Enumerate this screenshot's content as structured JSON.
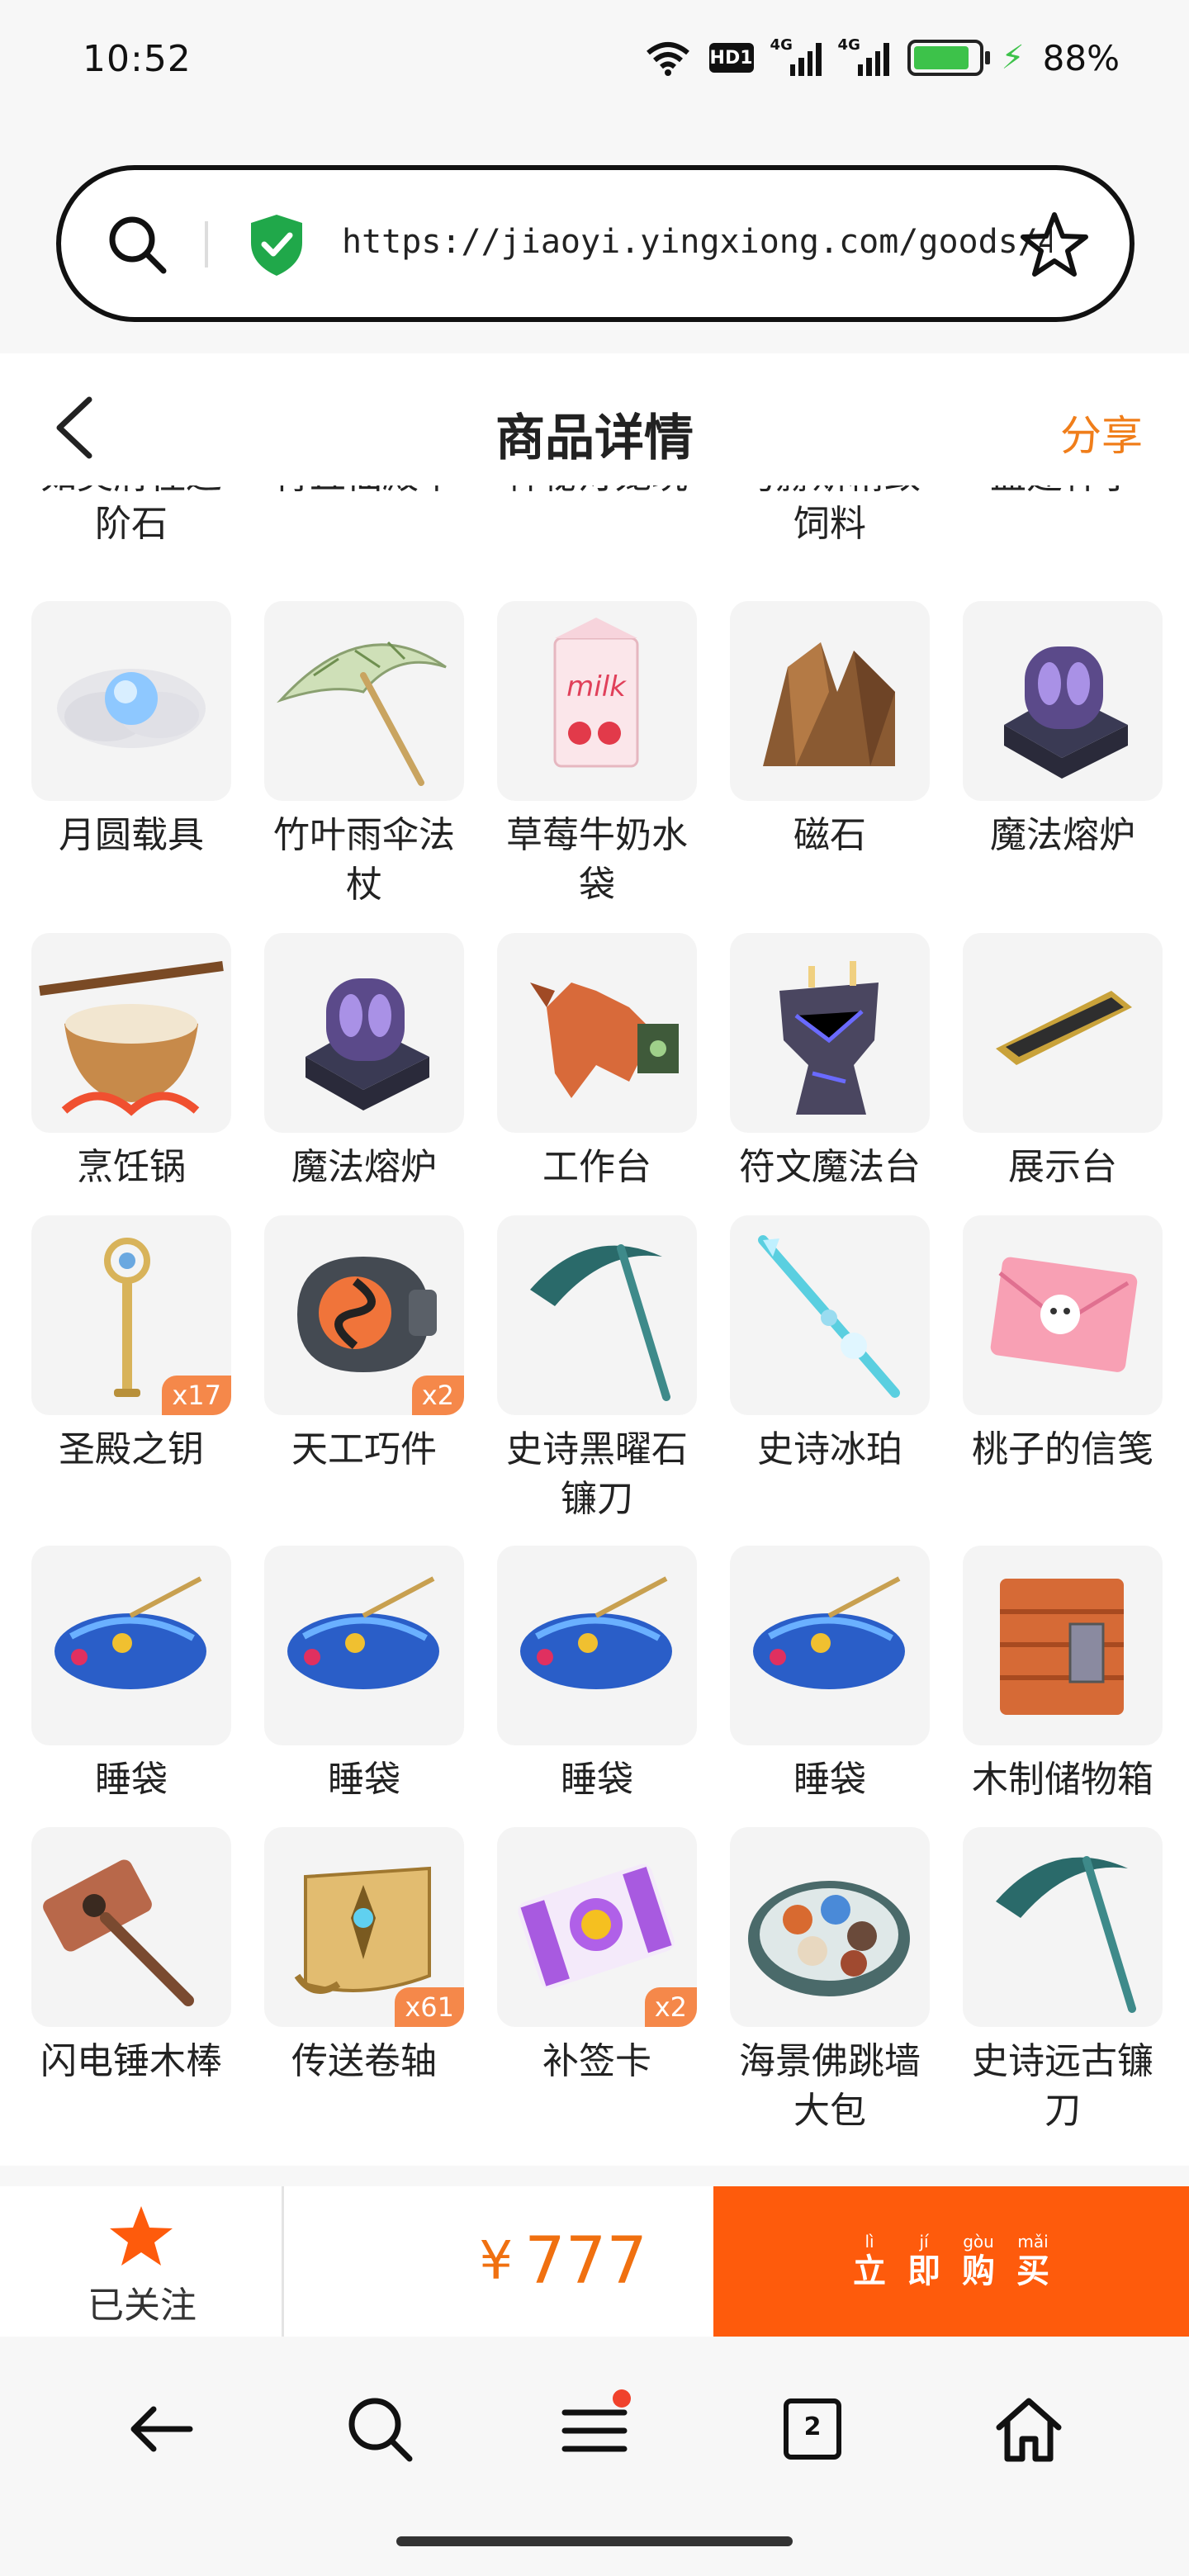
{
  "status_bar": {
    "time": "10:52",
    "hd_label": "HD1",
    "signal_1": "4G",
    "signal_2": "4G",
    "battery_percent": "88%",
    "battery_level": 0.88,
    "battery_color": "#3dc24a"
  },
  "address_bar": {
    "url": "https://jiaoyi.yingxiong.com/goods/43…",
    "secure_icon": "shield-check-icon",
    "secure_color": "#20a84a"
  },
  "header": {
    "title": "商品详情",
    "share_label": "分享",
    "share_color": "#f07e1a"
  },
  "cut_off_row": [
    {
      "line1": "如灵府往返",
      "line2": "阶石"
    },
    {
      "line1": "青丘仙殿草",
      "line2": ""
    },
    {
      "line1": "神秘灯笼玩",
      "line2": ""
    },
    {
      "line1": "马赫斯精致",
      "line2": "饲料"
    },
    {
      "line1": "盖建杆子",
      "line2": ""
    }
  ],
  "items": [
    {
      "name": "月圆载具",
      "qty": "",
      "icon": "moon-orb-icon"
    },
    {
      "name": "竹叶雨伞法杖",
      "qty": "",
      "icon": "bamboo-umbrella-icon"
    },
    {
      "name": "草莓牛奶水袋",
      "qty": "",
      "icon": "milk-carton-icon"
    },
    {
      "name": "磁石",
      "qty": "",
      "icon": "magnet-rock-icon"
    },
    {
      "name": "魔法熔炉",
      "qty": "",
      "icon": "magic-furnace-icon"
    },
    {
      "name": "烹饪锅",
      "qty": "",
      "icon": "cooking-pot-icon"
    },
    {
      "name": "魔法熔炉",
      "qty": "",
      "icon": "magic-furnace-icon"
    },
    {
      "name": "工作台",
      "qty": "",
      "icon": "workbench-icon"
    },
    {
      "name": "符文魔法台",
      "qty": "",
      "icon": "rune-altar-icon"
    },
    {
      "name": "展示台",
      "qty": "",
      "icon": "display-stand-icon"
    },
    {
      "name": "圣殿之钥",
      "qty": "x17",
      "icon": "temple-key-icon"
    },
    {
      "name": "天工巧件",
      "qty": "x2",
      "icon": "craft-part-icon"
    },
    {
      "name": "史诗黑曜石镰刀",
      "qty": "",
      "icon": "scythe-icon"
    },
    {
      "name": "史诗冰珀",
      "qty": "",
      "icon": "ice-spear-icon"
    },
    {
      "name": "桃子的信笺",
      "qty": "",
      "icon": "letter-icon"
    },
    {
      "name": "睡袋",
      "qty": "",
      "icon": "sleeping-bag-icon"
    },
    {
      "name": "睡袋",
      "qty": "",
      "icon": "sleeping-bag-icon"
    },
    {
      "name": "睡袋",
      "qty": "",
      "icon": "sleeping-bag-icon"
    },
    {
      "name": "睡袋",
      "qty": "",
      "icon": "sleeping-bag-icon"
    },
    {
      "name": "木制储物箱",
      "qty": "",
      "icon": "wooden-crate-icon"
    },
    {
      "name": "闪电锤木棒",
      "qty": "",
      "icon": "hammer-icon"
    },
    {
      "name": "传送卷轴",
      "qty": "x61",
      "icon": "scroll-icon"
    },
    {
      "name": "补签卡",
      "qty": "x2",
      "icon": "ticket-icon"
    },
    {
      "name": "海景佛跳墙大包",
      "qty": "",
      "icon": "food-platter-icon"
    },
    {
      "name": "史诗远古镰刀",
      "qty": "",
      "icon": "scythe-icon"
    }
  ],
  "action_bar": {
    "follow_label": "已关注",
    "follow_icon": "star-filled-icon",
    "currency": "¥",
    "price": "777",
    "buy_chars": [
      {
        "pinyin": "lì",
        "hanzi": "立"
      },
      {
        "pinyin": "jí",
        "hanzi": "即"
      },
      {
        "pinyin": "gòu",
        "hanzi": "购"
      },
      {
        "pinyin": "mǎi",
        "hanzi": "买"
      }
    ],
    "buy_color": "#fe5b0c",
    "price_color": "#f07010"
  },
  "nav_bar": {
    "tab_count": "2",
    "buttons": [
      "back-arrow-icon",
      "search-icon",
      "menu-icon",
      "tabs-icon",
      "home-icon"
    ]
  }
}
